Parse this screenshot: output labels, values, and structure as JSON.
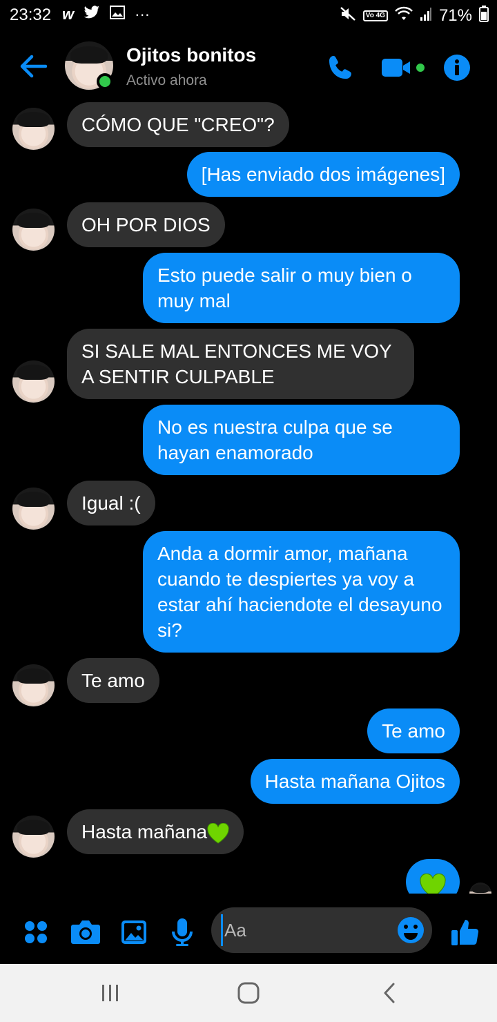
{
  "status_bar": {
    "time": "23:32",
    "battery": "71%",
    "left_icons": [
      "w-app-icon",
      "twitter-icon",
      "gallery-icon",
      "more-icon"
    ],
    "right_icons": [
      "mute-icon",
      "volte-4g-icon",
      "wifi-icon",
      "signal-icon",
      "battery-icon"
    ],
    "volte_label": "Vo 4G"
  },
  "header": {
    "name": "Ojitos bonitos",
    "status": "Activo ahora",
    "accent": "#0a8cf7",
    "active_color": "#31c84b"
  },
  "messages": [
    {
      "from": "them",
      "text": "CÓMO QUE \"CREO\"?"
    },
    {
      "from": "me",
      "text": "[Has enviado dos imágenes]"
    },
    {
      "from": "them",
      "text": "OH POR DIOS"
    },
    {
      "from": "me",
      "text": "Esto puede salir o muy bien o muy mal"
    },
    {
      "from": "them",
      "text": "SI SALE MAL ENTONCES ME VOY A SENTIR CULPABLE"
    },
    {
      "from": "me",
      "text": "No es nuestra culpa que se hayan enamorado"
    },
    {
      "from": "them",
      "text": "Igual :("
    },
    {
      "from": "me",
      "text": "Anda a dormir amor, mañana cuando te despiertes ya voy a estar ahí haciendote el desayuno si?"
    },
    {
      "from": "them",
      "text": "Te amo"
    },
    {
      "from": "me",
      "text": "Te amo"
    },
    {
      "from": "me",
      "text": "Hasta mañana Ojitos"
    },
    {
      "from": "them",
      "text": "Hasta mañana",
      "emoji": "green-heart"
    },
    {
      "from": "me",
      "text": "",
      "emoji": "green-heart"
    }
  ],
  "composer": {
    "placeholder": "Aa",
    "buttons": [
      "menu-dots-icon",
      "camera-icon",
      "image-icon",
      "microphone-icon",
      "emoji-icon",
      "thumbs-up-icon"
    ]
  },
  "colors": {
    "outgoing_bubble": "#0a8cf7",
    "incoming_bubble": "#303030",
    "background": "#000000",
    "heart": "#6fd400"
  }
}
